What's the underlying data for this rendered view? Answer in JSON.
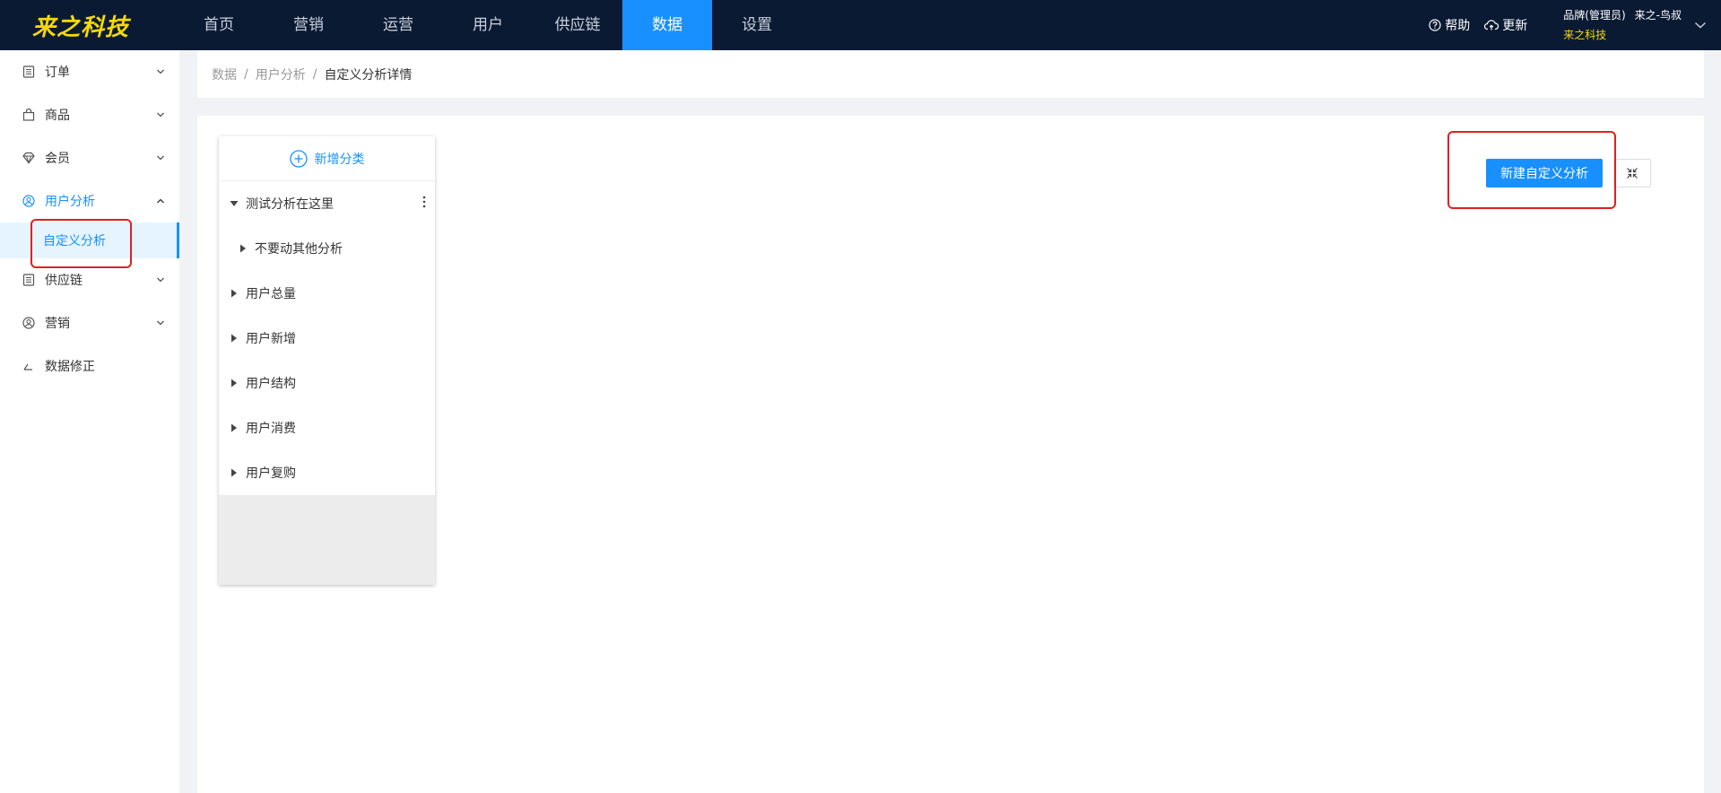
{
  "brand": {
    "logo_text": "来之科技"
  },
  "topnav": {
    "items": [
      {
        "label": "首页"
      },
      {
        "label": "营销"
      },
      {
        "label": "运营"
      },
      {
        "label": "用户"
      },
      {
        "label": "供应链"
      },
      {
        "label": "数据",
        "active": true
      },
      {
        "label": "设置"
      }
    ],
    "help_label": "帮助",
    "update_label": "更新"
  },
  "user": {
    "role": "品牌(管理员)",
    "name": "来之-鸟叔",
    "org": "来之科技"
  },
  "sidebar": {
    "items": [
      {
        "label": "订单",
        "icon": "document-icon"
      },
      {
        "label": "商品",
        "icon": "bag-icon"
      },
      {
        "label": "会员",
        "icon": "gem-icon"
      },
      {
        "label": "用户分析",
        "icon": "user-circle-icon",
        "open": true
      },
      {
        "label": "供应链",
        "icon": "document-icon"
      },
      {
        "label": "营销",
        "icon": "user-circle-icon"
      },
      {
        "label": "数据修正",
        "icon": "edit-angle-icon"
      }
    ],
    "sub_item": "自定义分析"
  },
  "breadcrumb": [
    "数据",
    "用户分析",
    "自定义分析详情"
  ],
  "tree": {
    "add_label": "新增分类",
    "items": [
      {
        "label": "测试分析在这里",
        "expanded": true
      },
      {
        "label": "不要动其他分析",
        "child": true
      },
      {
        "label": "用户总量"
      },
      {
        "label": "用户新增"
      },
      {
        "label": "用户结构"
      },
      {
        "label": "用户消费"
      },
      {
        "label": "用户复购"
      }
    ]
  },
  "actions": {
    "new_analysis_label": "新建自定义分析"
  },
  "colors": {
    "accent": "#1890ff",
    "topbar": "#0b1a33",
    "logo": "#f5d90a",
    "annotation": "#e02020"
  }
}
